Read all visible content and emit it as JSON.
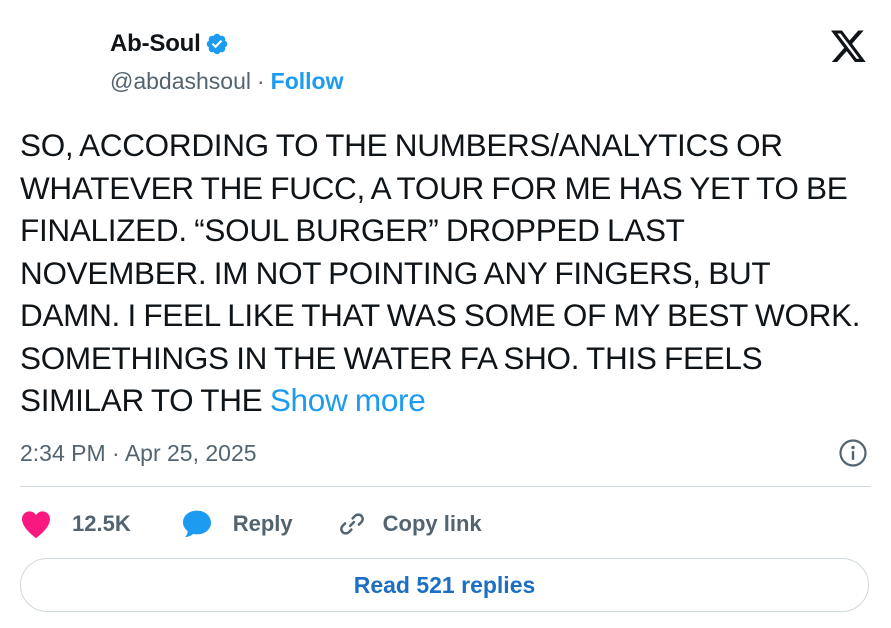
{
  "author": {
    "display_name": "Ab-Soul",
    "handle": "@abdashsoul",
    "separator": "·",
    "follow_label": "Follow",
    "verified_icon": "verified-badge-icon"
  },
  "brand": {
    "logo": "x-logo-icon"
  },
  "tweet": {
    "text": "SO, ACCORDING TO THE NUMBERS/ANALYTICS OR WHATEVER THE FUCC, A TOUR FOR ME HAS YET TO BE FINALIZED.  “SOUL BURGER” DROPPED LAST NOVEMBER. IM NOT POINTING ANY FINGERS, BUT DAMN. I FEEL LIKE THAT WAS SOME OF MY BEST WORK. SOMETHINGS IN THE WATER FA SHO. THIS FEELS SIMILAR TO THE",
    "show_more_label": "Show more",
    "timestamp": "2:34 PM · Apr 25, 2025"
  },
  "actions": {
    "like_count": "12.5K",
    "reply_label": "Reply",
    "copy_link_label": "Copy link"
  },
  "replies_button_label": "Read 521 replies",
  "colors": {
    "accent": "#1d9bf0",
    "like": "#f91880",
    "text": "#0f1419",
    "muted": "#536471",
    "border": "#cfd9de"
  }
}
